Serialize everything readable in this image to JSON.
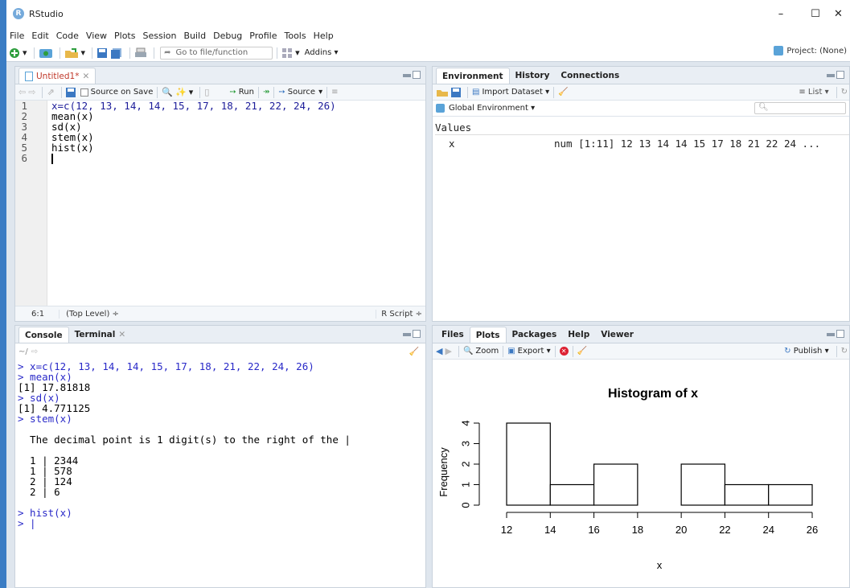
{
  "window": {
    "title": "RStudio",
    "app_icon_letter": "R",
    "min": "–",
    "max": "☐",
    "close": "✕"
  },
  "menu": [
    "File",
    "Edit",
    "Code",
    "View",
    "Plots",
    "Session",
    "Build",
    "Debug",
    "Profile",
    "Tools",
    "Help"
  ],
  "toolbar": {
    "goto_placeholder": "Go to file/function",
    "addins": "Addins",
    "project": "Project: (None)"
  },
  "editor": {
    "tab": "Untitled1*",
    "source_on_save": "Source on Save",
    "run": "Run",
    "source": "Source",
    "lines": [
      {
        "n": "1",
        "code": "x=c(12, 13, 14, 14, 15, 17, 18, 21, 22, 24, 26)"
      },
      {
        "n": "2",
        "code": "mean(x)"
      },
      {
        "n": "3",
        "code": "sd(x)"
      },
      {
        "n": "4",
        "code": "stem(x)"
      },
      {
        "n": "5",
        "code": "hist(x)"
      },
      {
        "n": "6",
        "code": ""
      }
    ],
    "status_pos": "6:1",
    "status_scope": "(Top Level) ÷",
    "status_type": "R Script ÷"
  },
  "console": {
    "tabs": [
      "Console",
      "Terminal"
    ],
    "path": "~/",
    "lines": [
      {
        "kind": "cmd",
        "text": "> x=c(12, 13, 14, 14, 15, 17, 18, 21, 22, 24, 26)"
      },
      {
        "kind": "cmd",
        "text": "> mean(x)"
      },
      {
        "kind": "out",
        "text": "[1] 17.81818"
      },
      {
        "kind": "cmd",
        "text": "> sd(x)"
      },
      {
        "kind": "out",
        "text": "[1] 4.771125"
      },
      {
        "kind": "cmd",
        "text": "> stem(x)"
      },
      {
        "kind": "out",
        "text": ""
      },
      {
        "kind": "out",
        "text": "  The decimal point is 1 digit(s) to the right of the |"
      },
      {
        "kind": "out",
        "text": ""
      },
      {
        "kind": "out",
        "text": "  1 | 2344"
      },
      {
        "kind": "out",
        "text": "  1 | 578"
      },
      {
        "kind": "out",
        "text": "  2 | 124"
      },
      {
        "kind": "out",
        "text": "  2 | 6"
      },
      {
        "kind": "out",
        "text": ""
      },
      {
        "kind": "cmd",
        "text": "> hist(x)"
      },
      {
        "kind": "cmd",
        "text": "> |"
      }
    ]
  },
  "environment": {
    "tabs": [
      "Environment",
      "History",
      "Connections"
    ],
    "import_dataset": "Import Dataset",
    "list_view": "List",
    "scope": "Global Environment",
    "section": "Values",
    "var_name": "x",
    "var_value": "num [1:11] 12 13 14 14 15 17 18 21 22 24 ..."
  },
  "plots_pane": {
    "tabs": [
      "Files",
      "Plots",
      "Packages",
      "Help",
      "Viewer"
    ],
    "zoom": "Zoom",
    "export": "Export",
    "publish": "Publish"
  },
  "chart_data": {
    "type": "bar",
    "title": "Histogram of x",
    "xlabel": "x",
    "ylabel": "Frequency",
    "bins": [
      [
        12,
        14
      ],
      [
        14,
        16
      ],
      [
        16,
        18
      ],
      [
        18,
        20
      ],
      [
        20,
        22
      ],
      [
        22,
        24
      ],
      [
        24,
        26
      ]
    ],
    "values": [
      4,
      1,
      2,
      0,
      2,
      1,
      1
    ],
    "x_ticks": [
      "12",
      "14",
      "16",
      "18",
      "20",
      "22",
      "24",
      "26"
    ],
    "y_ticks": [
      "0",
      "1",
      "2",
      "3",
      "4"
    ],
    "xlim": [
      12,
      26
    ],
    "ylim": [
      0,
      4
    ]
  }
}
